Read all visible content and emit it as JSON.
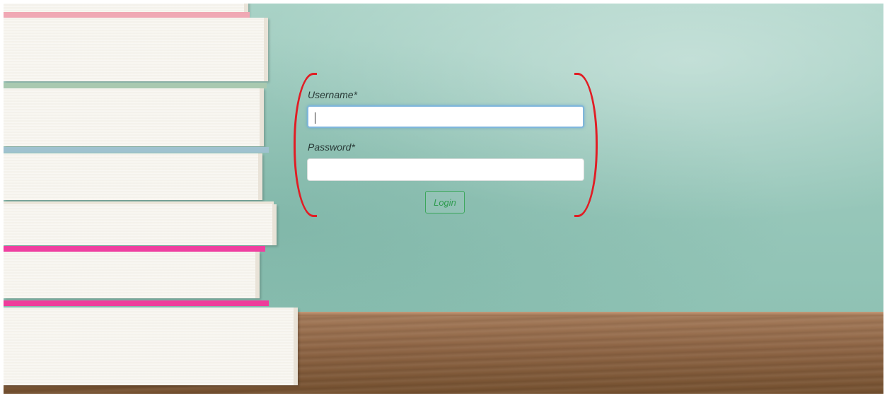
{
  "login_form": {
    "username_label": "Username*",
    "username_value": "",
    "password_label": "Password*",
    "password_value": "",
    "login_label": "Login"
  },
  "colors": {
    "bracket": "#e11d24",
    "login_button": "#2e9b4f",
    "focus_ring": "#7fb6dc"
  }
}
